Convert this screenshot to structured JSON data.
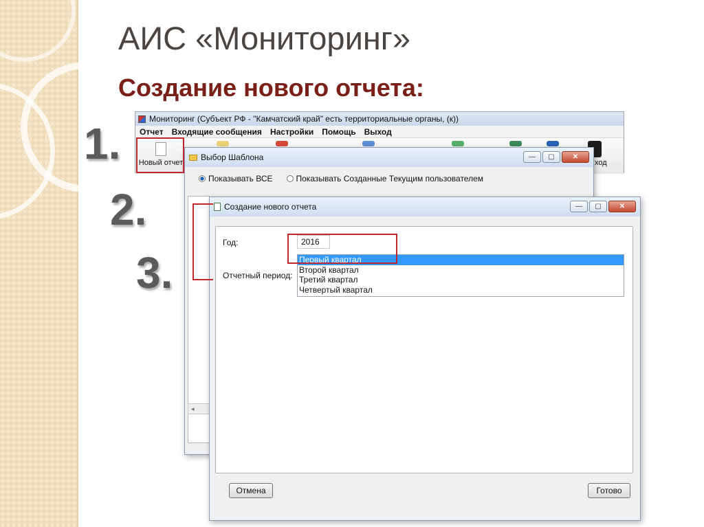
{
  "slide": {
    "title": "АИС «Мониторинг»",
    "subtitle": "Создание нового отчета:",
    "steps": [
      "1.",
      "2.",
      "3."
    ]
  },
  "app": {
    "title": "Мониторинг (Субъект РФ - \"Камчатский край\" есть территориальные органы, (к))",
    "menu": [
      "Отчет",
      "Входящие сообщения",
      "Настройки",
      "Помощь",
      "Выход"
    ],
    "toolbar": {
      "new_report_label": "Новый отчет",
      "exit_label_partial": "ход"
    }
  },
  "template_window": {
    "title": "Выбор Шаблона",
    "radio_all": "Показывать ВСЕ",
    "radio_user": "Показывать Созданные Текущим пользователем",
    "radio_all_selected": true,
    "scroll_left": "◂"
  },
  "create_window": {
    "title": "Создание нового отчета",
    "year_label": "Год:",
    "year_value": "2016",
    "period_label": "Отчетный период:",
    "periods": [
      "Первый квартал",
      "Второй квартал",
      "Третий квартал",
      "Четвертый квартал"
    ],
    "selected_period": "Первый квартал",
    "cancel_label": "Отмена",
    "done_label": "Готово"
  },
  "window_controls": {
    "minimize": "—",
    "maximize": "▢",
    "close": "✕"
  },
  "colors": {
    "title_text": "#4a4540",
    "subtitle_text": "#7a2018",
    "highlight_box": "#c0272d",
    "selection": "#3399ff",
    "deco_strip": "#f1dfbe"
  },
  "icons": [
    "document-icon",
    "folder-icon",
    "form-icon",
    "exit-icon",
    "minimize-icon",
    "maximize-icon",
    "close-icon"
  ]
}
